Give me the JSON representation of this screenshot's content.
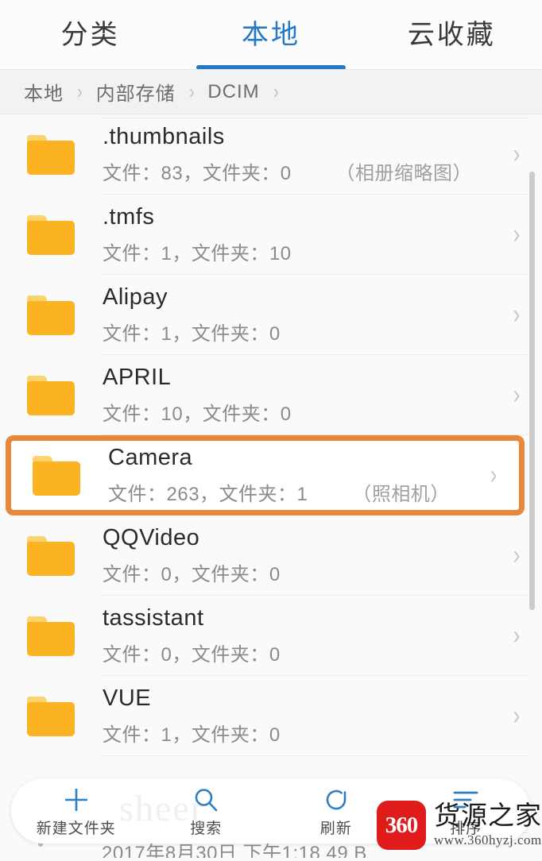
{
  "tabs": [
    {
      "label": "分类",
      "active": false
    },
    {
      "label": "本地",
      "active": true
    },
    {
      "label": "云收藏",
      "active": false
    }
  ],
  "breadcrumb": {
    "items": [
      "本地",
      "内部存储",
      "DCIM"
    ],
    "separator": "›"
  },
  "rows": [
    {
      "name": ".thumbnails",
      "meta": "文件：83，文件夹：0",
      "note": "（相册缩略图）",
      "chevron": "›",
      "highlighted": false
    },
    {
      "name": ".tmfs",
      "meta": "文件：1，文件夹：10",
      "note": "",
      "chevron": "›",
      "highlighted": false
    },
    {
      "name": "Alipay",
      "meta": "文件：1，文件夹：0",
      "note": "",
      "chevron": "›",
      "highlighted": false
    },
    {
      "name": "APRIL",
      "meta": "文件：10，文件夹：0",
      "note": "",
      "chevron": "›",
      "highlighted": false
    },
    {
      "name": "Camera",
      "meta": "文件：263，文件夹：1",
      "note": "（照相机）",
      "chevron": "›",
      "highlighted": true
    },
    {
      "name": "QQVideo",
      "meta": "文件：0，文件夹：0",
      "note": "",
      "chevron": "›",
      "highlighted": false
    },
    {
      "name": "tassistant",
      "meta": "文件：0，文件夹：0",
      "note": "",
      "chevron": "›",
      "highlighted": false
    },
    {
      "name": "VUE",
      "meta": "文件：1，文件夹：0",
      "note": "",
      "chevron": "›",
      "highlighted": false
    }
  ],
  "partial_row": {
    "text": "2017年8月30日  下午1:18  49 B"
  },
  "toolbar": [
    {
      "label": "新建文件夹",
      "icon": "plus-icon"
    },
    {
      "label": "搜索",
      "icon": "search-icon"
    },
    {
      "label": "刷新",
      "icon": "refresh-icon"
    },
    {
      "label": "排序",
      "icon": "sort-icon"
    }
  ],
  "watermark": {
    "badge": "360",
    "name": "货源之家",
    "url": "www.360hyzj.com",
    "ghost": "sheer"
  },
  "colors": {
    "accent_blue": "#2577c8",
    "folder_orange": "#fbb322",
    "highlight_orange": "#e8883c",
    "badge_red": "#e01b1b"
  }
}
